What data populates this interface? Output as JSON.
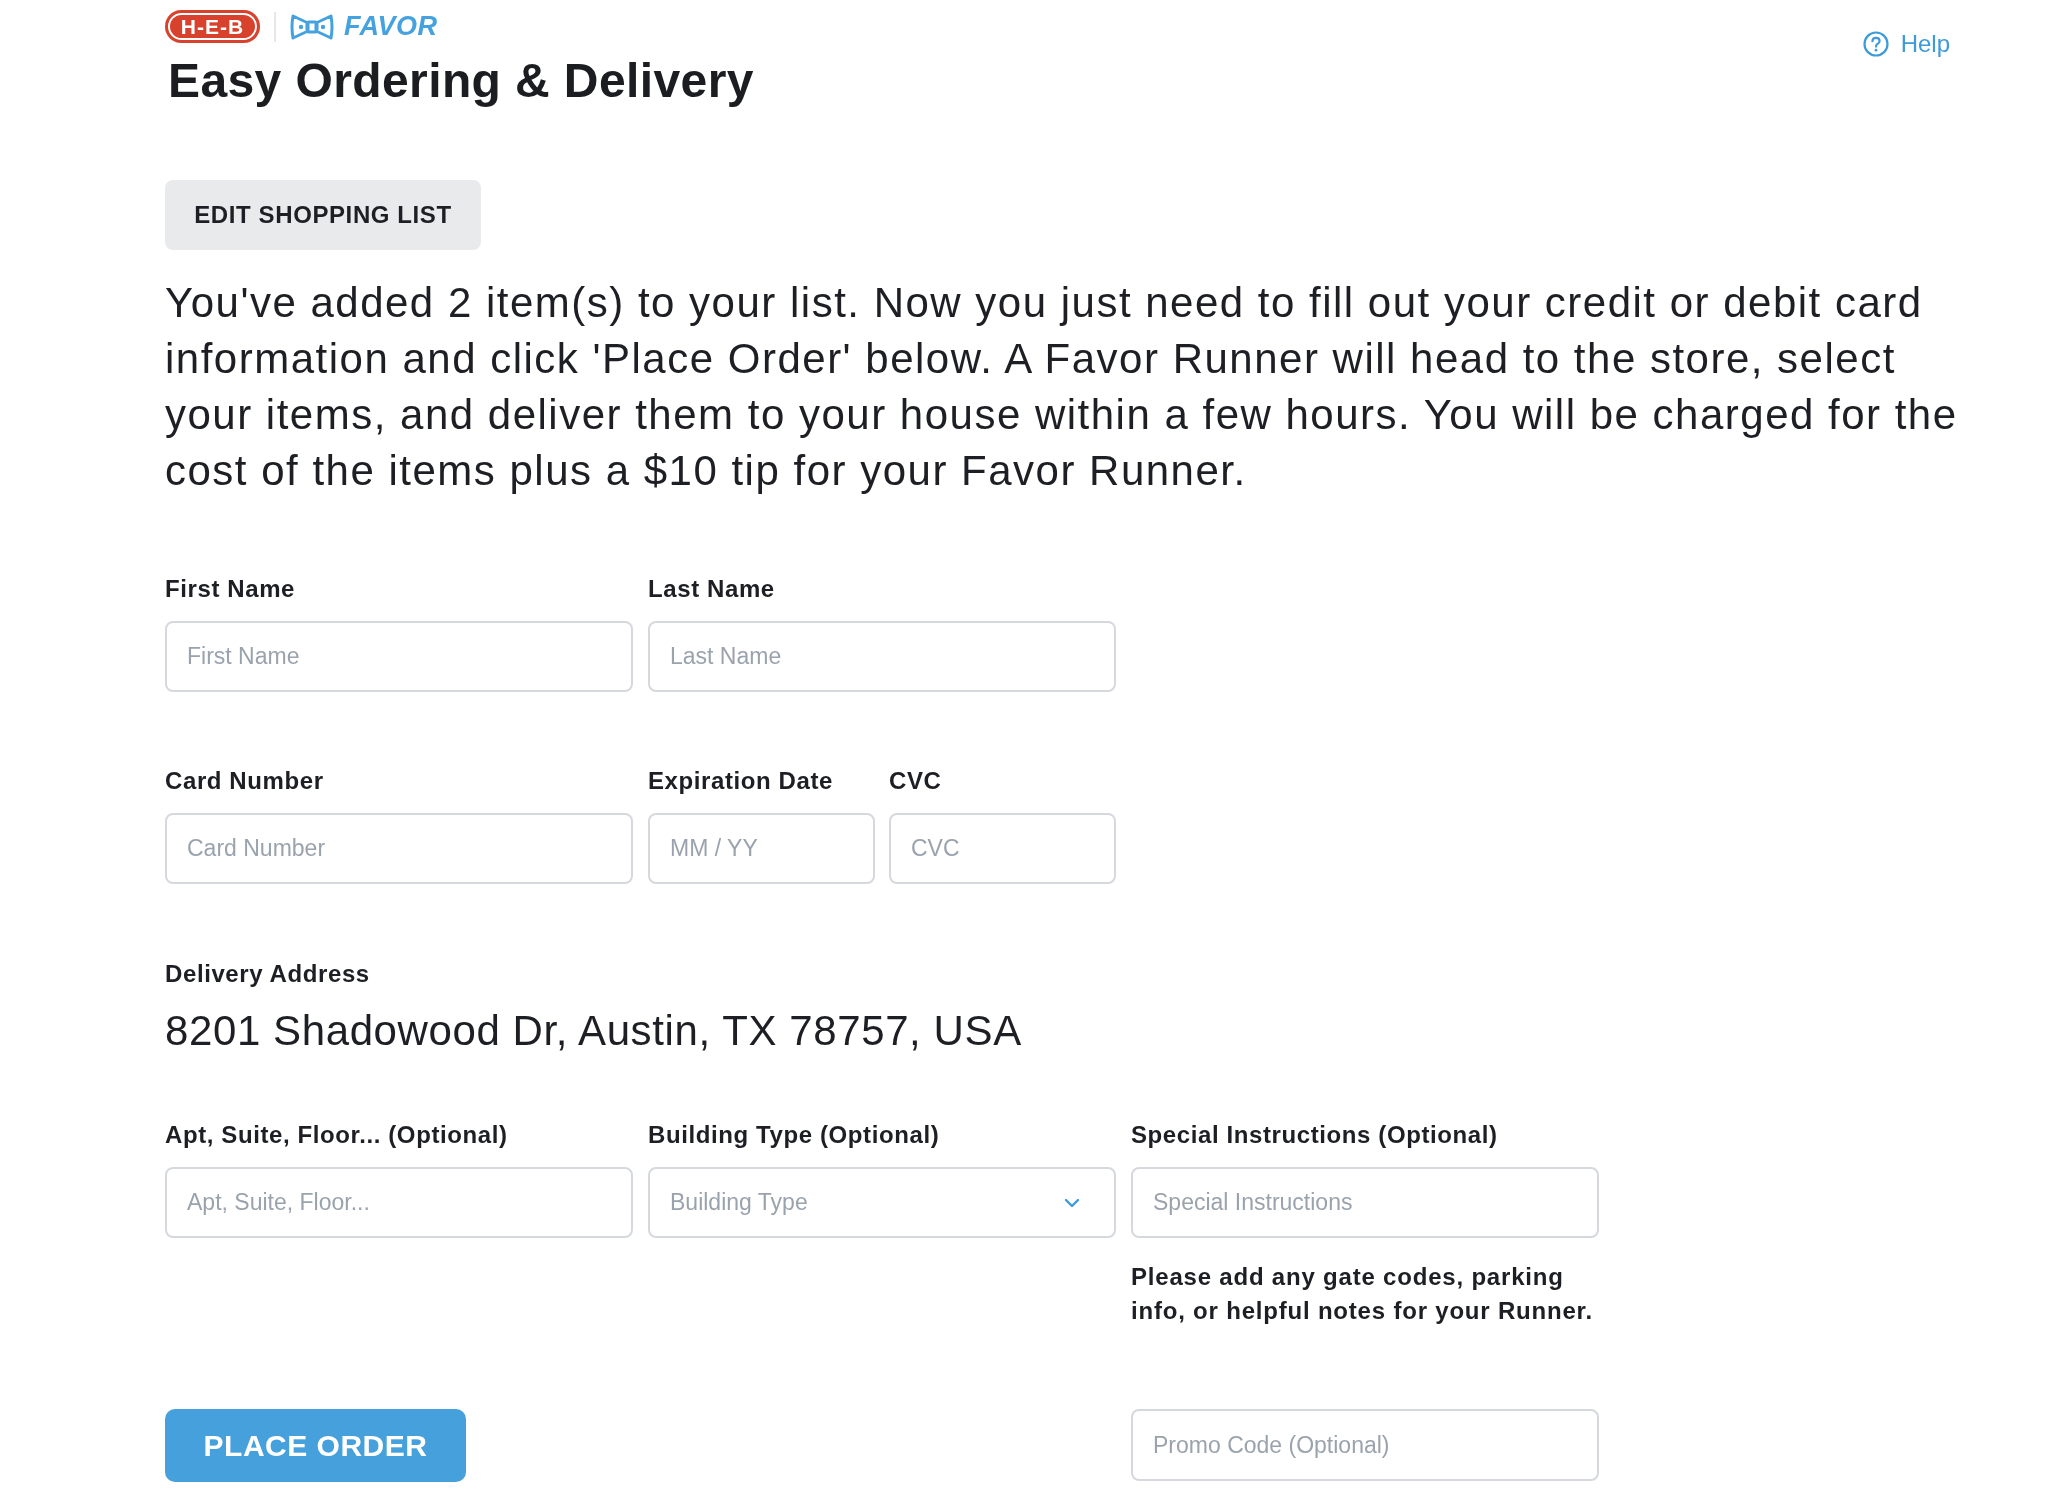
{
  "brand": {
    "store_logo": "H-E-B",
    "service_logo": "FAVOR"
  },
  "help_link": "Help",
  "title": "Easy Ordering & Delivery",
  "edit_button": "EDIT SHOPPING LIST",
  "intro": "You've added 2 item(s) to your list. Now you just need to fill out your credit or debit card information and click 'Place Order' below. A Favor Runner will head to the store, select your items, and deliver them to your house within a few hours. You will be charged for the cost of the items plus a $10 tip for your Favor Runner.",
  "name_fields": [
    {
      "label": "First Name",
      "placeholder": "First Name"
    },
    {
      "label": "Last Name",
      "placeholder": "Last Name"
    }
  ],
  "card_fields": [
    {
      "label": "Card Number",
      "placeholder": "Card Number"
    },
    {
      "label": "Expiration Date",
      "placeholder": "MM / YY"
    },
    {
      "label": "CVC",
      "placeholder": "CVC"
    }
  ],
  "delivery_address": {
    "label": "Delivery Address",
    "value": "8201 Shadowood Dr, Austin, TX 78757, USA"
  },
  "address_fields": [
    {
      "kind": "text",
      "label": "Apt, Suite, Floor... (Optional)",
      "placeholder": "Apt, Suite, Floor..."
    },
    {
      "kind": "select",
      "label": "Building Type (Optional)",
      "placeholder": "Building Type"
    },
    {
      "kind": "text",
      "label": "Special Instructions (Optional)",
      "placeholder": "Special Instructions",
      "hint": "Please add any gate codes, parking info, or helpful notes for your Runner."
    }
  ],
  "place_order_button": "PLACE ORDER",
  "promo_field": {
    "placeholder": "Promo Code (Optional)"
  }
}
